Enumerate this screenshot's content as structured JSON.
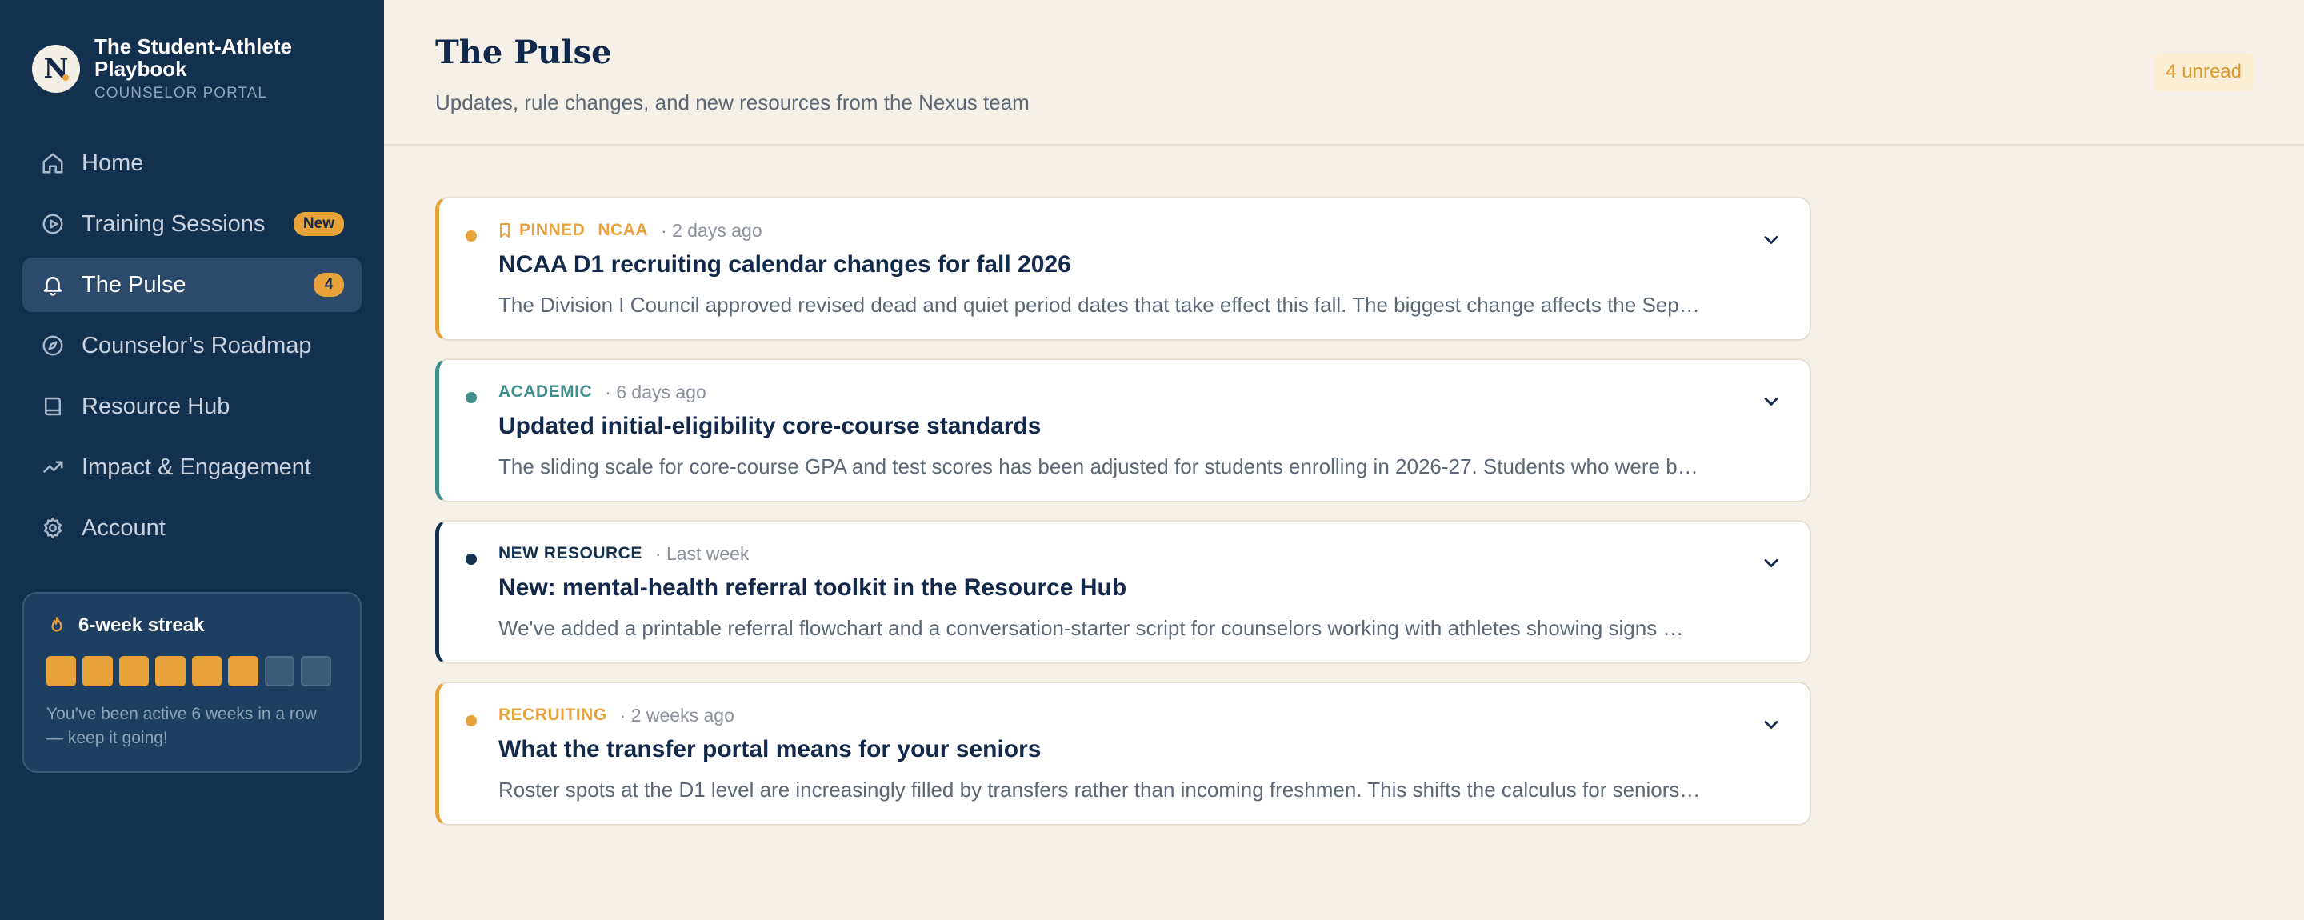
{
  "brand": {
    "logo_letter": "N",
    "title": "The Student-Athlete Playbook",
    "subtitle": "COUNSELOR PORTAL"
  },
  "nav": [
    {
      "label": "Home",
      "icon": "home-icon"
    },
    {
      "label": "Training Sessions",
      "icon": "play-circle-icon",
      "badge": "New"
    },
    {
      "label": "The Pulse",
      "icon": "bell-icon",
      "badge": "4",
      "active": true
    },
    {
      "label": "Counselor’s Roadmap",
      "icon": "compass-icon"
    },
    {
      "label": "Resource Hub",
      "icon": "book-icon"
    },
    {
      "label": "Impact & Engagement",
      "icon": "trending-up-icon"
    },
    {
      "label": "Account",
      "icon": "gear-icon"
    }
  ],
  "streak": {
    "title": "6-week streak",
    "weeks_active": 6,
    "weeks_total": 8,
    "text": "You’ve been active 6 weeks in a row — keep it going!"
  },
  "header": {
    "title": "The Pulse",
    "subtitle": "Updates, rule changes, and new resources from the Nexus team",
    "unread": "4 unread"
  },
  "posts": [
    {
      "pinned": "PINNED",
      "category": "NCAA",
      "time": "· 2 days ago",
      "title": "NCAA D1 recruiting calendar changes for fall 2026",
      "body": "The Division I Council approved revised dead and quiet period dates that take effect this fall. The biggest change affects the Sep…",
      "accent": "#e8a23a"
    },
    {
      "category": "ACADEMIC",
      "time": "· 6 days ago",
      "title": "Updated initial-eligibility core-course standards",
      "body": "The sliding scale for core-course GPA and test scores has been adjusted for students enrolling in 2026-27. Students who were b…",
      "accent": "#3f8f8c"
    },
    {
      "category": "NEW RESOURCE",
      "time": "· Last week",
      "title": "New: mental-health referral toolkit in the Resource Hub",
      "body": "We've added a printable referral flowchart and a conversation-starter script for counselors working with athletes showing signs …",
      "accent": "#13304f"
    },
    {
      "category": "RECRUITING",
      "time": "· 2 weeks ago",
      "title": "What the transfer portal means for your seniors",
      "body": "Roster spots at the D1 level are increasingly filled by transfers rather than incoming freshmen. This shifts the calculus for seniors…",
      "accent": "#e8a23a"
    }
  ]
}
